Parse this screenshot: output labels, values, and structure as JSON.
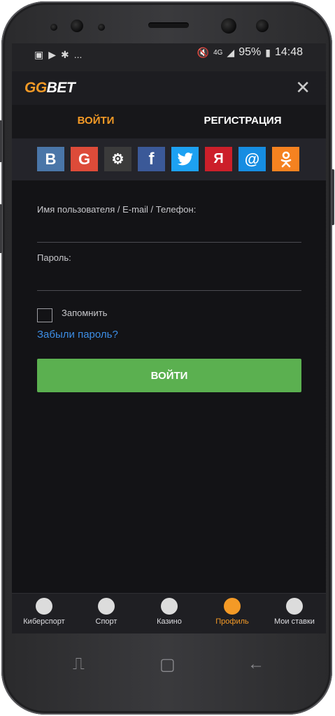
{
  "status_bar": {
    "left_icons": [
      "image-icon",
      "play-store-icon",
      "person-run-icon",
      "more-dots-icon"
    ],
    "more": "...",
    "network": "4G",
    "battery": "95%",
    "time": "14:48"
  },
  "header": {
    "logo_part1": "GG",
    "logo_part2": "BET",
    "close_icon": "close-icon"
  },
  "tabs": {
    "login": "ВОЙТИ",
    "register": "РЕГИСТРАЦИЯ"
  },
  "social": [
    {
      "name": "vk",
      "glyph": "B",
      "color": "#4a76a8"
    },
    {
      "name": "google",
      "glyph": "G",
      "color": "#dd4b39"
    },
    {
      "name": "steam",
      "glyph": "⚙",
      "color": "#3b3b3b"
    },
    {
      "name": "facebook",
      "glyph": "f",
      "color": "#3b5998"
    },
    {
      "name": "twitter",
      "glyph": "🐦",
      "color": "#1da1f2"
    },
    {
      "name": "yandex",
      "glyph": "Я",
      "color": "#cc1f2a"
    },
    {
      "name": "mail",
      "glyph": "@",
      "color": "#168de2"
    },
    {
      "name": "odnoklassniki",
      "glyph": "ок",
      "color": "#f58220"
    }
  ],
  "form": {
    "username_label": "Имя пользователя / E-mail / Телефон:",
    "username_value": "",
    "password_label": "Пароль:",
    "password_value": "",
    "remember_label": "Запомнить",
    "remember_checked": false,
    "forgot_link": "Забыли пароль?",
    "submit_label": "ВОЙТИ"
  },
  "bottom_nav": [
    {
      "label": "Киберспорт",
      "icon": "gamepad-icon",
      "active": false
    },
    {
      "label": "Спорт",
      "icon": "soccer-ball-icon",
      "active": false
    },
    {
      "label": "Казино",
      "icon": "roulette-icon",
      "active": false
    },
    {
      "label": "Профиль",
      "icon": "user-icon",
      "active": true
    },
    {
      "label": "Мои ставки",
      "icon": "bets-icon",
      "active": false
    }
  ],
  "colors": {
    "accent": "#f49a26",
    "button_green": "#5bb050",
    "link_blue": "#3d8ee6",
    "background": "#131316"
  }
}
